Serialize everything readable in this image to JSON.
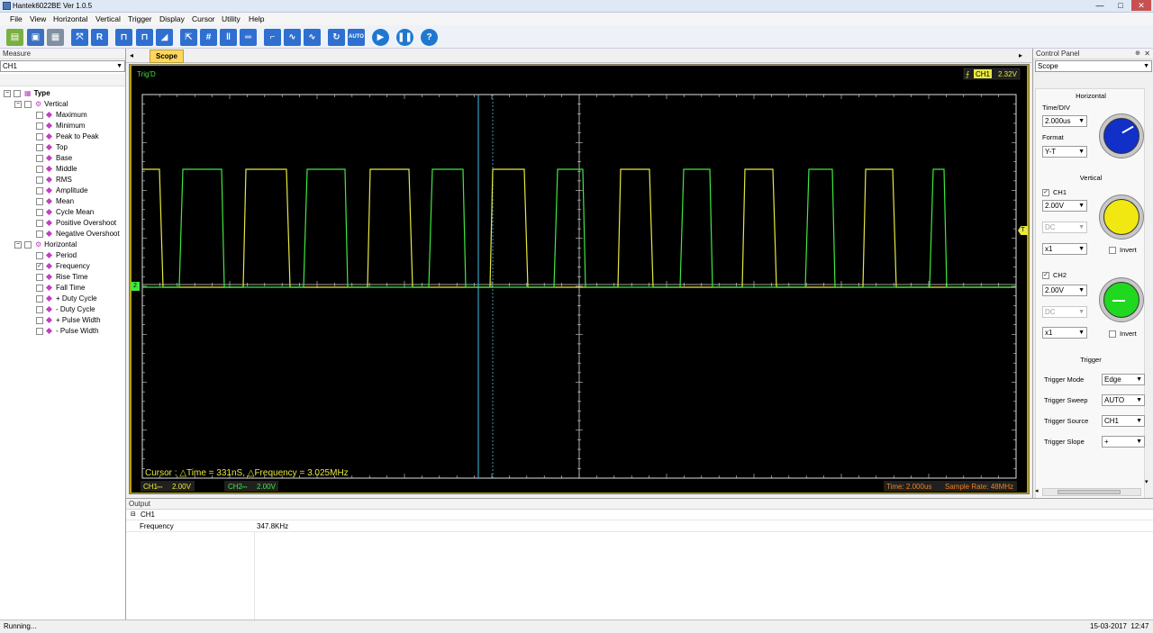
{
  "window": {
    "title": "Hantek6022BE Ver 1.0.5",
    "buttons": [
      "—",
      "□",
      "✕"
    ]
  },
  "menu": [
    "File",
    "View",
    "Horizontal",
    "Vertical",
    "Trigger",
    "Display",
    "Cursor",
    "Utility",
    "Help"
  ],
  "toolbar": {
    "icons": [
      "open-icon",
      "save-icon",
      "print-icon",
      "autoset-icon",
      "r-icon",
      "pulse-icon",
      "pulse-narrow-icon",
      "sawtooth-icon",
      "cursor-select-icon",
      "grid-icon",
      "cursor-vertical-icon",
      "cursor-horizontal-icon",
      "step-icon",
      "sine-icon",
      "sine-wide-icon",
      "refresh-icon",
      "auto-icon",
      "run-icon",
      "pause-icon",
      "help-icon"
    ],
    "r_label": "R",
    "auto_label": "AUTO",
    "help_label": "?"
  },
  "measure": {
    "header": "Measure",
    "channel": "CH1",
    "tree_root": "Type",
    "vertical": {
      "label": "Vertical",
      "items": [
        "Maximum",
        "Minimum",
        "Peak to Peak",
        "Top",
        "Base",
        "Middle",
        "RMS",
        "Amplitude",
        "Mean",
        "Cycle Mean",
        "Positive Overshoot",
        "Negative Overshoot"
      ]
    },
    "horizontal": {
      "label": "Horizontal",
      "items": [
        "Period",
        "Frequency",
        "Rise Time",
        "Fall Time",
        "+ Duty Cycle",
        "- Duty Cycle",
        "+ Pulse Width",
        "- Pulse Width"
      ],
      "checked": "Frequency"
    }
  },
  "scope": {
    "tab_label": "Scope",
    "trig_status": "Trig'D",
    "trigger_channel": "CH1",
    "trigger_level": "2.32V",
    "cursor_readout": "Cursor : △Time = 331nS, △Frequency = 3.025MHz",
    "ch1_label": "CH1",
    "ch1_volts": "2.00V",
    "ch2_label": "CH2",
    "ch2_volts": "2.00V",
    "time_readout": "Time: 2.000us",
    "sample_rate": "Sample Rate: 48MHz",
    "ground_marker": "2",
    "trigger_marker": "T",
    "colors": {
      "ch1": "#e8e840",
      "ch2": "#40e840",
      "cursor": "#40c0e8",
      "grid": "#d8d8d8",
      "frame": "#b8a000"
    },
    "timebase": "2.000us/div",
    "traces": {
      "ch1_signal": "square wave",
      "ch2_signal": "square wave"
    }
  },
  "control_panel": {
    "header": "Control Panel",
    "page": "Scope",
    "horizontal_title": "Horizontal",
    "time_div_label": "Time/DIV",
    "time_div_value": "2.000us",
    "format_label": "Format",
    "format_value": "Y-T",
    "vertical_title": "Vertical",
    "ch1_label": "CH1",
    "ch1_volts": "2.00V",
    "ch1_coupling": "DC",
    "ch1_probe": "x1",
    "ch1_invert": "Invert",
    "ch2_label": "CH2",
    "ch2_volts": "2.00V",
    "ch2_coupling": "DC",
    "ch2_probe": "x1",
    "ch2_invert": "Invert",
    "trigger_title": "Trigger",
    "trigger_mode_label": "Trigger Mode",
    "trigger_mode_value": "Edge",
    "trigger_sweep_label": "Trigger Sweep",
    "trigger_sweep_value": "AUTO",
    "trigger_source_label": "Trigger Source",
    "trigger_source_value": "CH1",
    "trigger_slope_label": "Trigger Slope",
    "trigger_slope_value": "+",
    "knob_colors": {
      "horizontal": "#1030c8",
      "ch1": "#f0e810",
      "ch2": "#20d820"
    }
  },
  "output": {
    "header": "Output",
    "group": "CH1",
    "rows": [
      {
        "name": "Frequency",
        "value": "347.8KHz"
      }
    ]
  },
  "status": {
    "text": "Running...",
    "datetime": "15-03-2017  12:47"
  }
}
